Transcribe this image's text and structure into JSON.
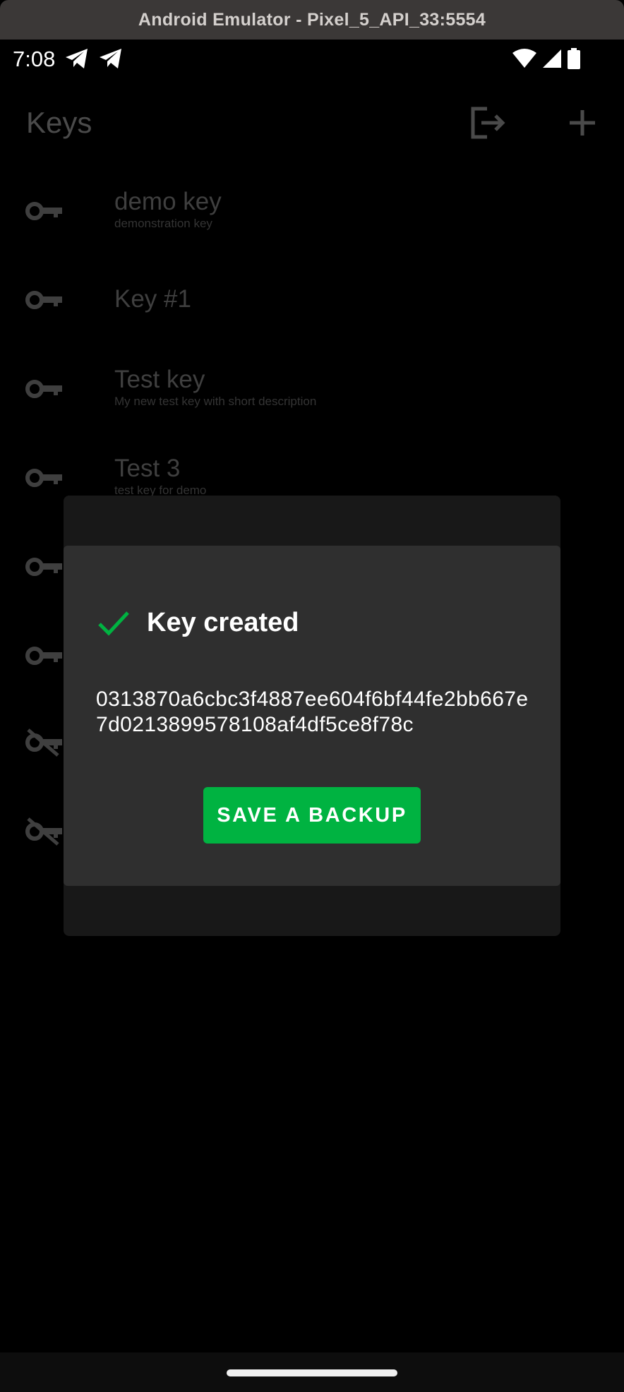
{
  "emulator": {
    "title": "Android Emulator - Pixel_5_API_33:5554"
  },
  "status_bar": {
    "time": "7:08",
    "left_icons": [
      "telegram-icon",
      "telegram-icon"
    ],
    "right_icons": [
      "wifi-icon",
      "signal-icon",
      "battery-icon"
    ]
  },
  "app_bar": {
    "title": "Keys",
    "actions": [
      "logout-icon",
      "add-icon"
    ]
  },
  "keys": [
    {
      "name": "demo key",
      "description": "demonstration key",
      "icon": "key-icon"
    },
    {
      "name": "Key #1",
      "description": "",
      "icon": "key-icon"
    },
    {
      "name": "Test key",
      "description": "My new test key with short description",
      "icon": "key-icon"
    },
    {
      "name": "Test 3",
      "description": "test key for demo",
      "icon": "key-icon"
    },
    {
      "name": "",
      "description": "",
      "icon": "key-icon"
    },
    {
      "name": "",
      "description": "",
      "icon": "key-icon"
    },
    {
      "name": "",
      "description": "",
      "icon": "key-off-icon"
    },
    {
      "name": "",
      "description": "",
      "icon": "key-off-icon"
    }
  ],
  "dialog": {
    "title": "Key created",
    "icon": "check-icon",
    "key_hex": "0313870a6cbc3f4887ee604f6bf44fe2bb667e7d0213899578108af4df5ce8f78c",
    "button_label": "SAVE A BACKUP"
  },
  "colors": {
    "accent": "#00b341",
    "dialog_bg": "#2f2f2f",
    "scrim_text": "#3f3f3f"
  }
}
